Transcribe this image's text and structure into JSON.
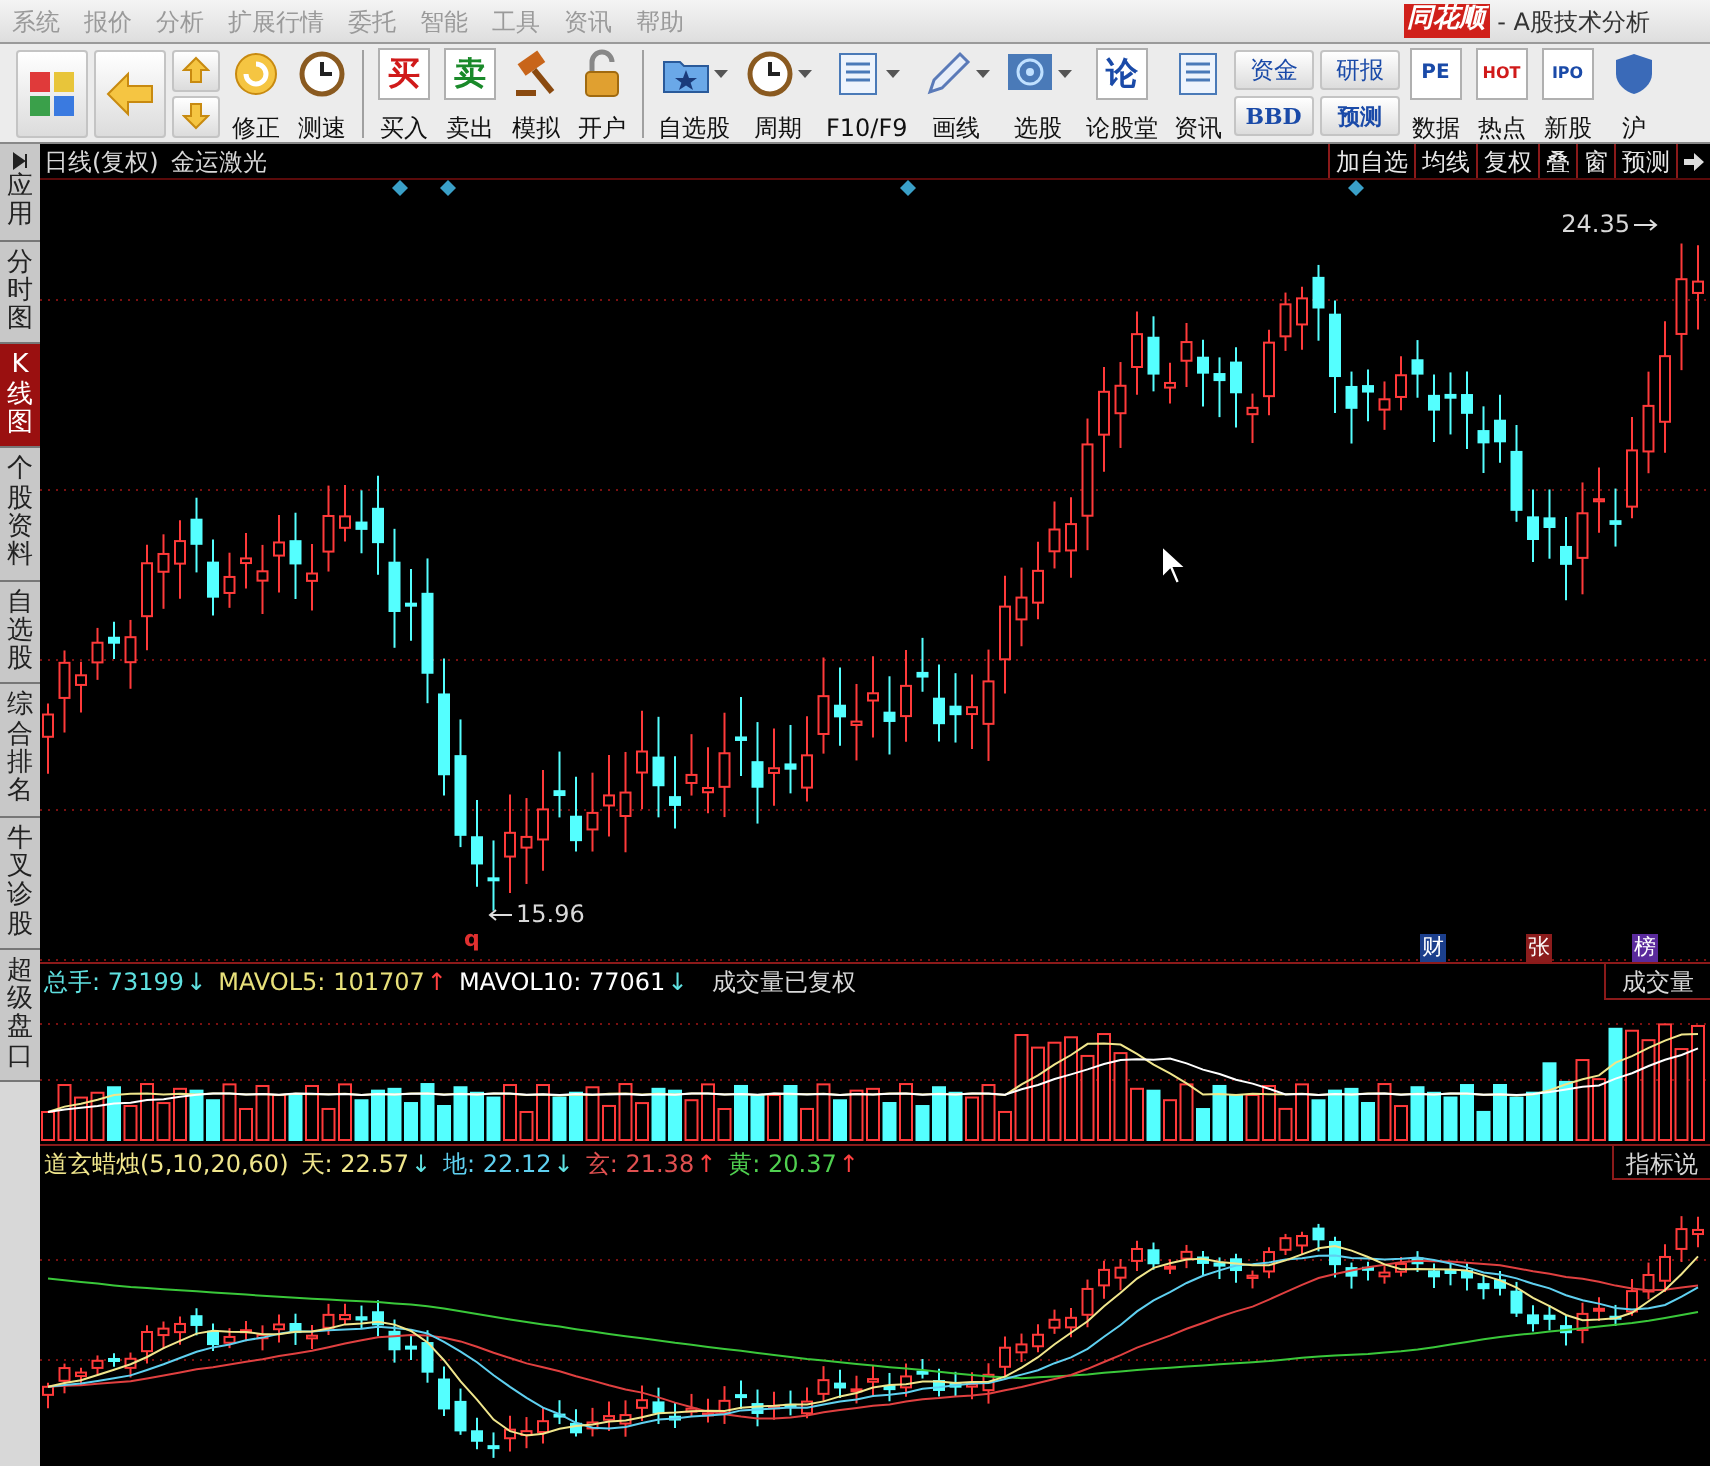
{
  "menu": [
    "系统",
    "报价",
    "分析",
    "扩展行情",
    "委托",
    "智能",
    "工具",
    "资讯",
    "帮助"
  ],
  "title": {
    "brand": "同花顺",
    "text": "- A股技术分析"
  },
  "toolbar": [
    {
      "kind": "big"
    },
    {
      "kind": "big"
    },
    {
      "kind": "pair"
    },
    {
      "kind": "button",
      "label": "修正"
    },
    {
      "kind": "button",
      "label": "测速"
    },
    {
      "kind": "sep"
    },
    {
      "kind": "button",
      "glyph": "买",
      "label": "买入"
    },
    {
      "kind": "button",
      "glyph": "卖",
      "label": "卖出"
    },
    {
      "kind": "button",
      "label": "模拟"
    },
    {
      "kind": "button",
      "label": "开户"
    },
    {
      "kind": "sep"
    },
    {
      "kind": "button",
      "label": "自选股",
      "dropdown": true
    },
    {
      "kind": "button",
      "label": "周期",
      "dropdown": true
    },
    {
      "kind": "button",
      "label": "F10/F9",
      "dropdown": true
    },
    {
      "kind": "button",
      "label": "画线",
      "dropdown": true
    },
    {
      "kind": "button",
      "label": "选股",
      "dropdown": true
    },
    {
      "kind": "button",
      "glyph": "论",
      "label": "论股堂"
    },
    {
      "kind": "button",
      "label": "资讯"
    },
    {
      "kind": "stack",
      "top": "资金",
      "bottom": "BBD"
    },
    {
      "kind": "stack",
      "top": "研报",
      "bottom": "预测"
    },
    {
      "kind": "button",
      "glyph": "PE",
      "label": "数据"
    },
    {
      "kind": "button",
      "glyph": "HOT",
      "label": "热点"
    },
    {
      "kind": "button",
      "glyph": "IPO",
      "label": "新股"
    },
    {
      "kind": "button",
      "label": "沪"
    }
  ],
  "side_tabs": [
    {
      "label": "应用",
      "selected": false
    },
    {
      "label": "分时图",
      "selected": false
    },
    {
      "label": "K线图",
      "selected": true
    },
    {
      "label": "个股资料",
      "selected": false
    },
    {
      "label": "自选股",
      "selected": false
    },
    {
      "label": "综合排名",
      "selected": false
    },
    {
      "label": "牛叉诊股",
      "selected": false
    },
    {
      "label": "超级盘口",
      "selected": false
    }
  ],
  "chart": {
    "period": "日线(复权)",
    "stock": "金运激光",
    "buttons": [
      "加自选",
      "均线",
      "复权",
      "叠",
      "窗",
      "预测"
    ],
    "high_label": "24.35",
    "low_label": "15.96",
    "marker": "q",
    "badges": [
      {
        "text": "财",
        "color": "#1c3f8c"
      },
      {
        "text": "张",
        "color": "#8c1c1c"
      },
      {
        "text": "榜",
        "color": "#5a2a9c"
      }
    ]
  },
  "volume": {
    "items": [
      {
        "label": "总手:",
        "value": "73199",
        "arrow": "↓",
        "rising": false,
        "color": "#5fe0e0"
      },
      {
        "label": "MAVOL5:",
        "value": "101707",
        "arrow": "↑",
        "rising": true,
        "color": "#e8e07a"
      },
      {
        "label": "MAVOL10:",
        "value": "77061",
        "arrow": "↓",
        "rising": false,
        "color": "#ffffff"
      }
    ],
    "note": "成交量已复权",
    "button": "成交量"
  },
  "indicator": {
    "name": "道玄蜡烛(5,10,20,60)",
    "items": [
      {
        "label": "天:",
        "value": "22.57",
        "arrow": "↓",
        "rising": false,
        "color": "#f0e68c"
      },
      {
        "label": "地:",
        "value": "22.12",
        "arrow": "↓",
        "rising": false,
        "color": "#5fd0f0"
      },
      {
        "label": "玄:",
        "value": "21.38",
        "arrow": "↑",
        "rising": true,
        "color": "#e05050"
      },
      {
        "label": "黄:",
        "value": "20.37",
        "arrow": "↑",
        "rising": true,
        "color": "#50d050"
      }
    ],
    "button": "指标说"
  }
}
